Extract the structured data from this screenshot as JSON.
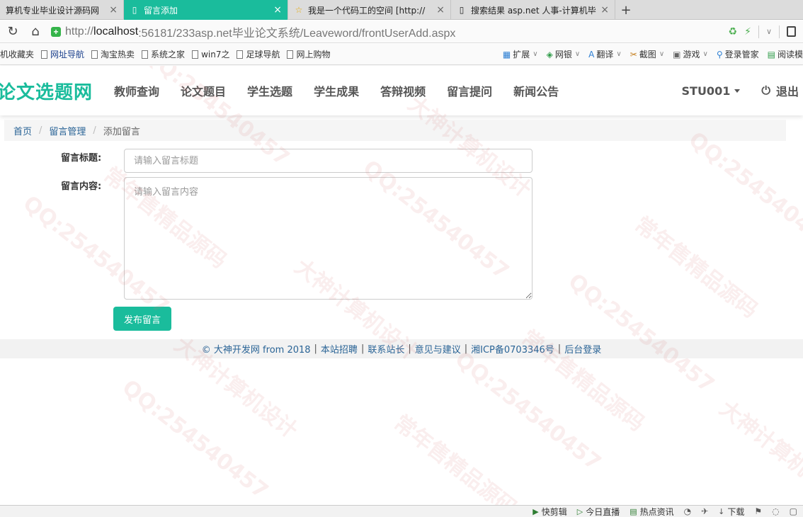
{
  "browser": {
    "tabs": [
      {
        "title": "算机专业毕业设计源码网",
        "active": false
      },
      {
        "title": "留言添加",
        "active": true
      },
      {
        "title": "我是一个代码工的空间 [http://",
        "active": false
      },
      {
        "title": "搜索结果 asp.net 人事-计算机毕",
        "active": false
      }
    ],
    "new_tab_label": "+",
    "url": {
      "scheme": "http://",
      "host": "localhost",
      "path": ":56181/233asp.net毕业论文系统/Leaveword/frontUserAdd.aspx"
    },
    "bookmarks": [
      {
        "label": "机收藏夹",
        "icon": "none",
        "style": "normal"
      },
      {
        "label": "网址导航",
        "icon": "doc",
        "style": "navy"
      },
      {
        "label": "淘宝热卖",
        "icon": "doc",
        "style": "normal"
      },
      {
        "label": "系统之家",
        "icon": "doc",
        "style": "normal"
      },
      {
        "label": "win7之",
        "icon": "doc",
        "style": "normal"
      },
      {
        "label": "足球导航",
        "icon": "doc",
        "style": "normal"
      },
      {
        "label": "网上购物",
        "icon": "doc",
        "style": "normal"
      }
    ],
    "toolbar_right": [
      {
        "label": "扩展",
        "icon": "▦"
      },
      {
        "label": "网银",
        "icon": "◈"
      },
      {
        "label": "翻译",
        "icon": "A"
      },
      {
        "label": "截图",
        "icon": "✂"
      },
      {
        "label": "游戏",
        "icon": "▣"
      },
      {
        "label": "登录管家",
        "icon": "⚲"
      },
      {
        "label": "阅读模",
        "icon": "▤"
      }
    ],
    "status_items": [
      {
        "label": "快剪辑",
        "icon": "▶"
      },
      {
        "label": "今日直播",
        "icon": "▷"
      },
      {
        "label": "热点资讯",
        "icon": "▤"
      },
      {
        "label": "下载",
        "icon": "↓"
      }
    ]
  },
  "site": {
    "brand": "论文选题网",
    "nav": [
      "教师查询",
      "论文题目",
      "学生选题",
      "学生成果",
      "答辩视频",
      "留言提问",
      "新闻公告"
    ],
    "user": "STU001",
    "logout": "退出"
  },
  "breadcrumb": {
    "home": "首页",
    "section": "留言管理",
    "current": "添加留言",
    "separator": "/"
  },
  "form": {
    "title_label": "留言标题:",
    "title_placeholder": "请输入留言标题",
    "title_value": "",
    "content_label": "留言内容:",
    "content_placeholder": "请输入留言内容",
    "content_value": "",
    "submit_label": "发布留言"
  },
  "footer": {
    "copyright": "© 大神开发网 from 2018",
    "links": [
      "本站招聘",
      "联系站长",
      "意见与建议",
      "湘ICP备0703346号",
      "后台登录"
    ]
  },
  "watermark": {
    "texts": [
      "QQ:254540457",
      "大神计算机设计",
      "常年售精品源码"
    ]
  },
  "colors": {
    "accent": "#1abc9c",
    "link": "#2a6496",
    "nav_text": "#555555"
  }
}
